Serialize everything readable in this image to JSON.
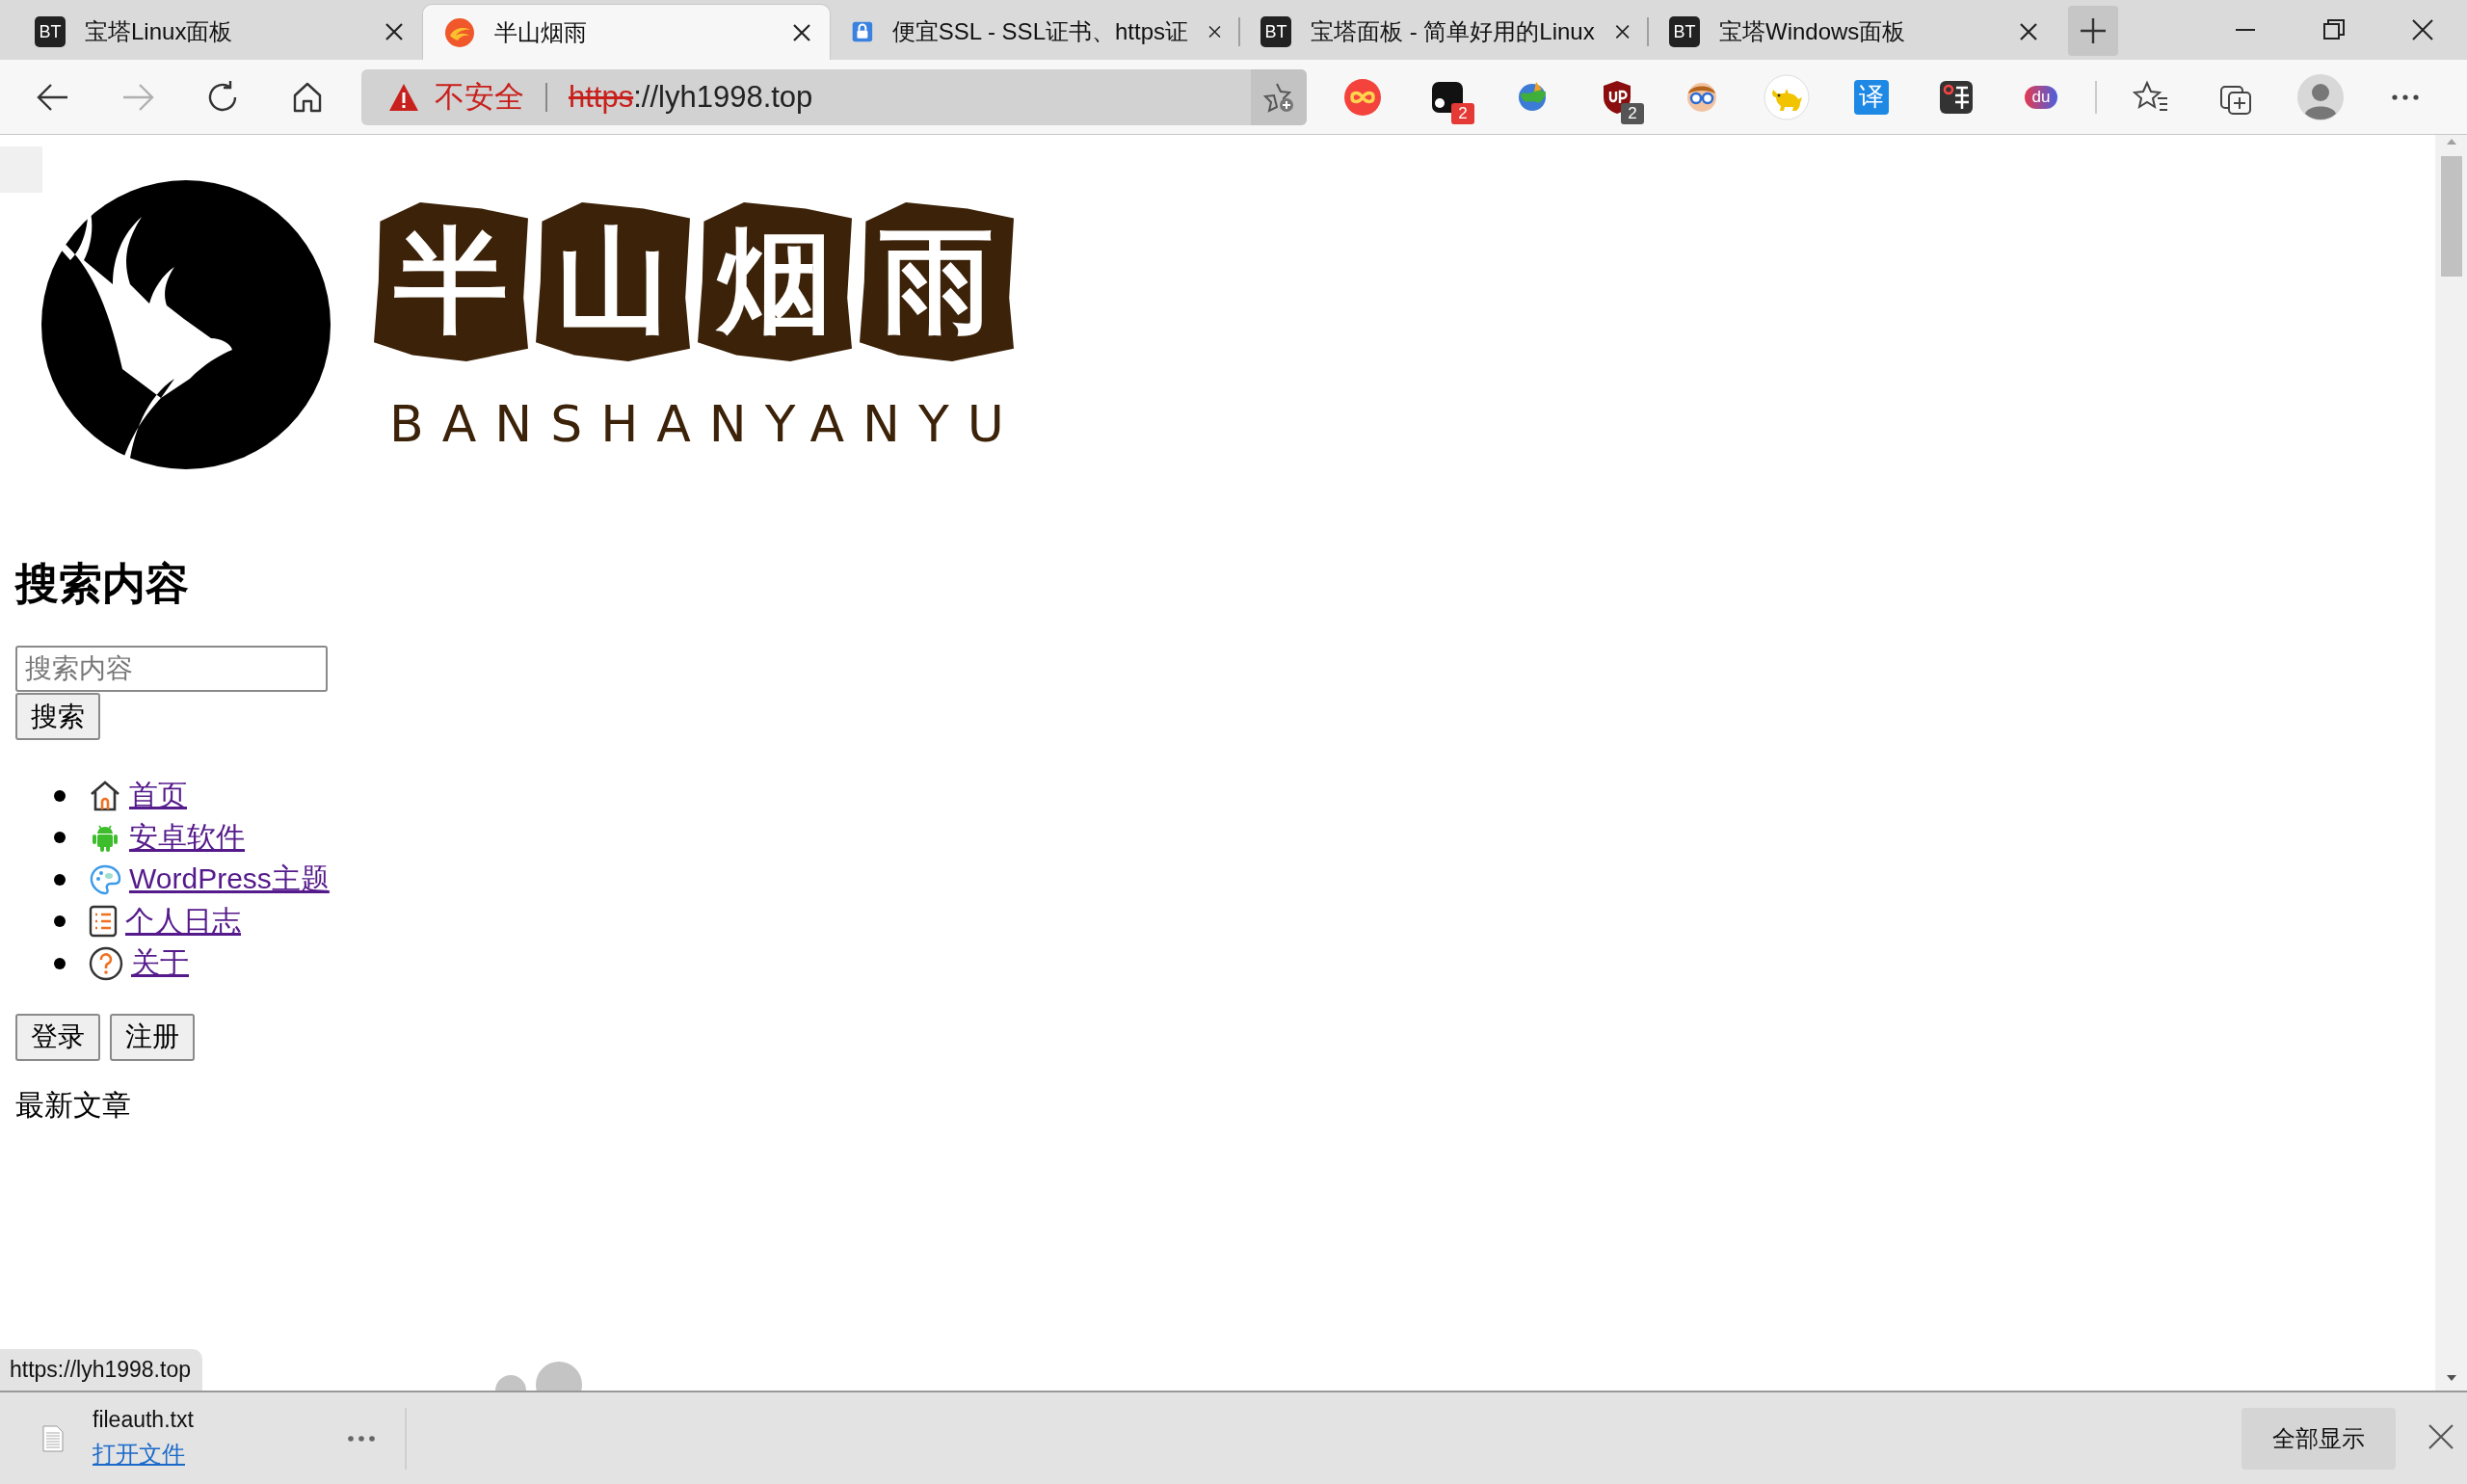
{
  "tabs": [
    {
      "kind": "bt",
      "favicon_text": "BT",
      "label": "宝塔Linux面板",
      "selected": false
    },
    {
      "kind": "swirl",
      "label": "半山烟雨",
      "selected": true
    },
    {
      "kind": "lock",
      "label": "便宜SSL - SSL证书、https证",
      "selected": false
    },
    {
      "kind": "bt",
      "favicon_text": "BT",
      "label": "宝塔面板 - 简单好用的Linux",
      "selected": false
    },
    {
      "kind": "bt",
      "favicon_text": "BT",
      "label": "宝塔Windows面板",
      "selected": false
    }
  ],
  "address_bar": {
    "warning": "不安全",
    "scheme": "https",
    "rest": "://lyh1998.top"
  },
  "extensions": [
    {
      "kind": "infinity"
    },
    {
      "kind": "square",
      "badge": "2"
    },
    {
      "kind": "globe"
    },
    {
      "kind": "shield",
      "badge": "2"
    },
    {
      "kind": "glasses"
    },
    {
      "kind": "cat"
    },
    {
      "kind": "translate",
      "text": "译"
    },
    {
      "kind": "stamp"
    },
    {
      "kind": "pill",
      "text": "du"
    }
  ],
  "logo": {
    "title": "半山烟雨",
    "subtitle": "BANSHANYANYU"
  },
  "page": {
    "heading": "搜索内容",
    "search": {
      "placeholder": "搜索内容",
      "button": "搜索"
    },
    "nav": [
      {
        "kind": "home",
        "label": "首页",
        "visited": true
      },
      {
        "kind": "android",
        "label": "安卓软件",
        "visited": true
      },
      {
        "kind": "palette",
        "label": "WordPress主题",
        "visited": true
      },
      {
        "kind": "list",
        "label": "个人日志",
        "visited": true
      },
      {
        "kind": "question",
        "label": "关于",
        "visited": true
      }
    ],
    "buttons": [
      "登录",
      "注册"
    ],
    "section_title": "最新文章"
  },
  "status_url": "https://lyh1998.top",
  "download": {
    "filename": "fileauth.txt",
    "action": "打开文件",
    "show_all": "全部显示"
  }
}
